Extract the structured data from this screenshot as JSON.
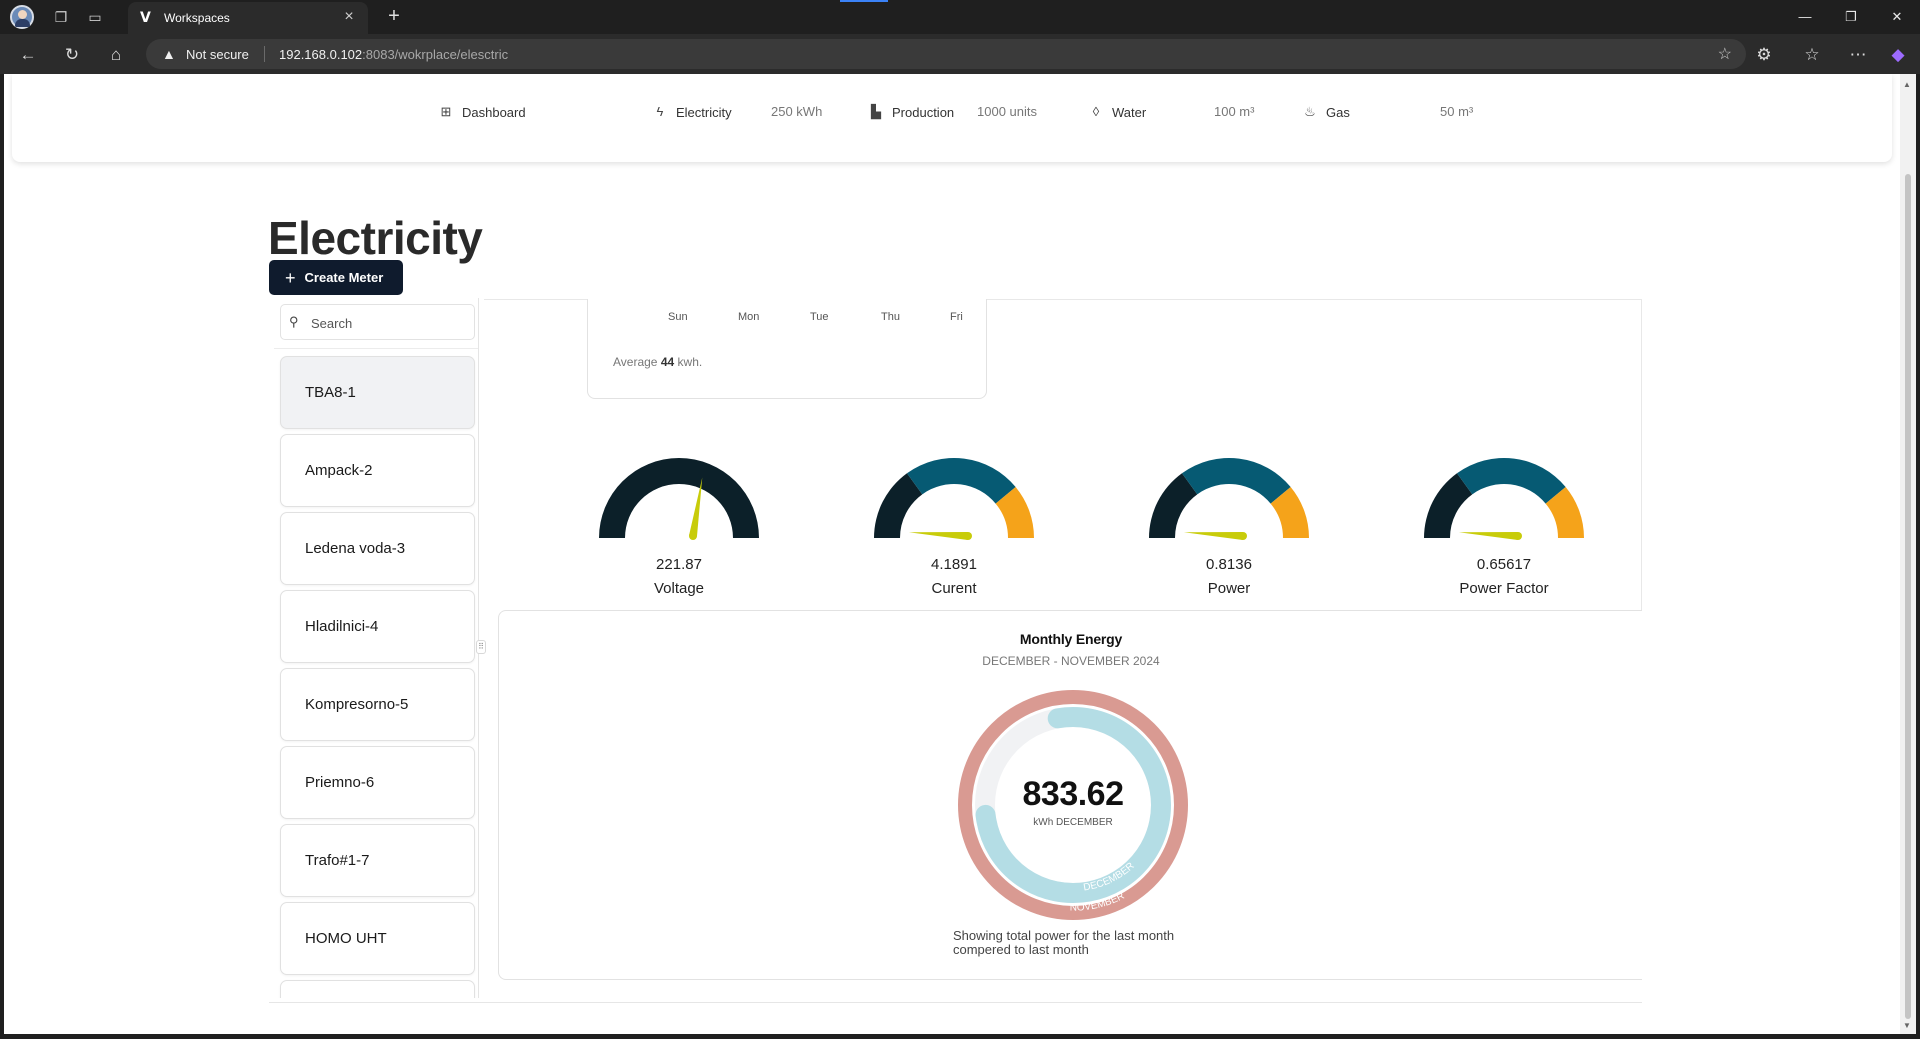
{
  "browser": {
    "tab_title": "Workspaces",
    "not_secure_label": "Not secure",
    "url_host": "192.168.0.102",
    "url_rest": ":8083/wokrplace/elesctric"
  },
  "topnav": {
    "dashboard_label": "Dashboard",
    "electricity_label": "Electricity",
    "electricity_value": "250 kWh",
    "production_label": "Production",
    "production_value": "1000 units",
    "water_label": "Water",
    "water_value": "100 m³",
    "gas_label": "Gas",
    "gas_value": "50 m³"
  },
  "page": {
    "title": "Electricity",
    "create_button_label": "Create Meter"
  },
  "sidebar": {
    "search_placeholder": "Search",
    "meters": [
      {
        "label": "TBA8-1"
      },
      {
        "label": "Ampack-2"
      },
      {
        "label": "Ledena voda-3"
      },
      {
        "label": "Hladilnici-4"
      },
      {
        "label": "Kompresorno-5"
      },
      {
        "label": "Priemno-6"
      },
      {
        "label": "Trafo#1-7"
      },
      {
        "label": "HOMO UHT"
      }
    ]
  },
  "weekly": {
    "days": [
      "Sun",
      "Mon",
      "Tue",
      "Thu",
      "Fri"
    ],
    "average_prefix": "Average",
    "average_value": "44",
    "average_suffix": "kwh."
  },
  "gauges": [
    {
      "label": "Voltage",
      "value": "221.87",
      "value_fraction": 0.55,
      "segment_colors": [
        "#0c2029"
      ]
    },
    {
      "label": "Curent",
      "value": "4.1891",
      "value_fraction": 0.02,
      "segment_colors": [
        "#0c2029",
        "#065a73",
        "#f5a31a"
      ]
    },
    {
      "label": "Power",
      "value": "0.8136",
      "value_fraction": 0.02,
      "segment_colors": [
        "#0c2029",
        "#065a73",
        "#f5a31a"
      ]
    },
    {
      "label": "Power Factor",
      "value": "0.65617",
      "value_fraction": 0.02,
      "segment_colors": [
        "#0c2029",
        "#065a73",
        "#f5a31a"
      ]
    }
  ],
  "monthly_energy": {
    "title": "Monthly Energy",
    "subtitle": "DECEMBER - NOVEMBER 2024",
    "value": "833.62",
    "unit_label": "kWh DECEMBER",
    "inner_ring_label": "DECEMBER",
    "outer_ring_label": "NOVEMBER",
    "footnote_line1": "Showing total power for the last month",
    "footnote_line2": "compered to last month",
    "colors": {
      "current": "#b4dde5",
      "previous": "#d99a92",
      "track": "#f1f2f4"
    }
  },
  "colors": {
    "accent_dark": "#0f1b2d",
    "gauge_needle": "#c8cc0a"
  }
}
